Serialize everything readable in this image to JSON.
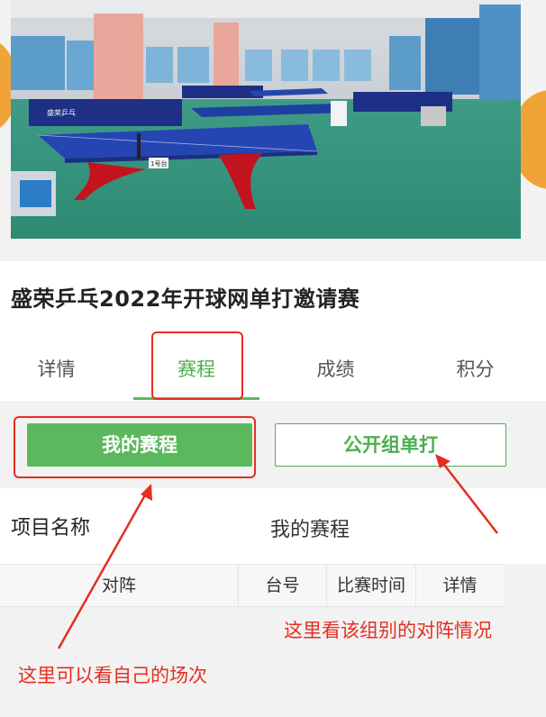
{
  "event": {
    "title": "盛荣乒乓2022年开球网单打邀请赛",
    "banner_sign": "盛荣乒乓",
    "table_tag": "1号台"
  },
  "tabs": [
    {
      "label": "详情"
    },
    {
      "label": "赛程"
    },
    {
      "label": "成绩"
    },
    {
      "label": "积分"
    }
  ],
  "active_tab": "赛程",
  "buttons": {
    "my_schedule": "我的赛程",
    "public_group": "公开组单打"
  },
  "project": {
    "label": "项目名称",
    "value": "我的赛程"
  },
  "table": {
    "headers": [
      "对阵",
      "台号",
      "比赛时间",
      "详情"
    ]
  },
  "annotations": {
    "right": "这里看该组别的对阵情况",
    "left": "这里可以看自己的场次"
  },
  "colors": {
    "accent_green": "#5cb85c",
    "annotation_red": "#e52e20"
  }
}
